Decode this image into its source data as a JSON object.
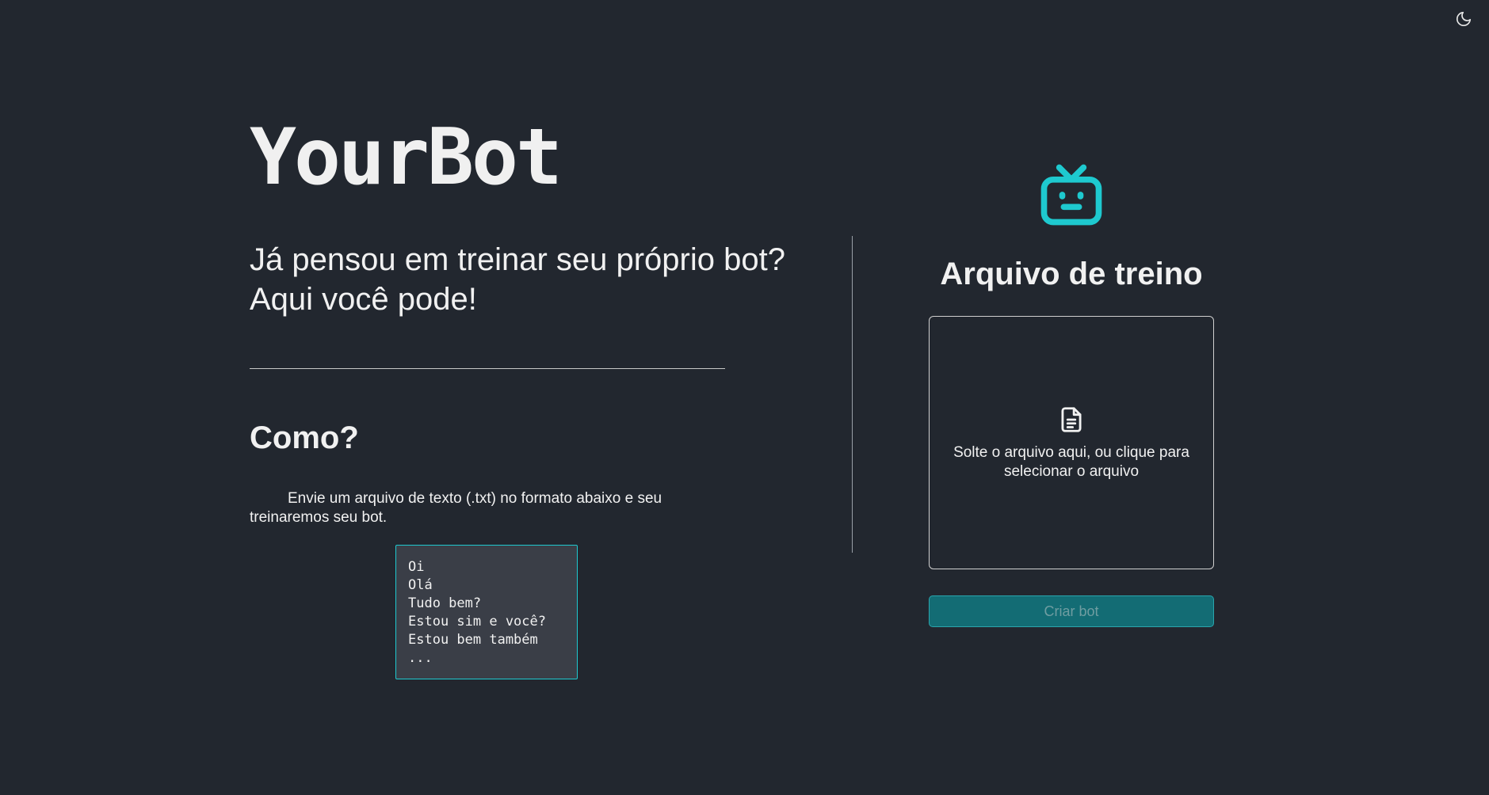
{
  "header": {
    "theme_toggle_icon": "moon-icon"
  },
  "hero": {
    "brand": "YourBot",
    "tagline_line1": "Já pensou em treinar seu próprio bot?",
    "tagline_line2": "Aqui você pode!"
  },
  "how": {
    "title": "Como?",
    "description": "Envie um arquivo de texto (.txt) no formato abaixo e seu treinaremos seu bot.",
    "example_lines": [
      "Oi",
      "Olá",
      "Tudo bem?",
      "Estou sim e você?",
      "Estou bem também",
      "..."
    ]
  },
  "upload": {
    "icon": "bot-tv-icon",
    "title": "Arquivo de treino",
    "dropzone_icon": "file-text-icon",
    "dropzone_text": "Solte o arquivo aqui, ou clique para selecionar o arquivo",
    "create_button_label": "Criar bot"
  },
  "colors": {
    "background": "#22272f",
    "accent": "#1ec9cf",
    "button_bg": "#136c74"
  }
}
